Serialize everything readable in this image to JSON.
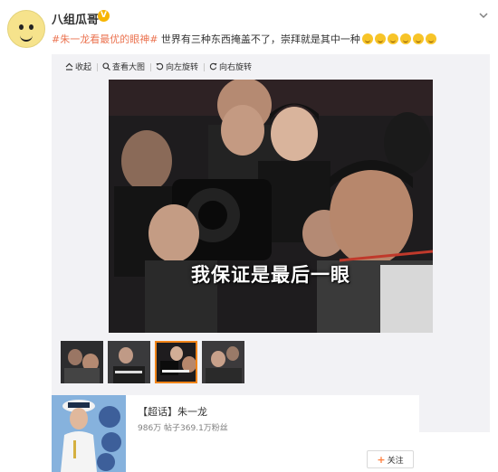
{
  "post": {
    "username": "八组瓜哥",
    "verified_badge": "V",
    "topic": "#朱一龙看最优的眼神#",
    "text": " 世界有三种东西掩盖不了，崇拜就是其中一种",
    "emoji_count": 6,
    "accent_color": "#eb7350"
  },
  "toolbar": {
    "collapse": "收起",
    "view_large": "查看大图",
    "rotate_left": "向左旋转",
    "rotate_right": "向右旋转"
  },
  "image": {
    "caption": "我保证是最后一眼"
  },
  "thumbnails": {
    "count": 4,
    "selected_index": 2
  },
  "super_topic": {
    "title": "【超话】朱一龙",
    "stats": "986万 帖子369.1万粉丝",
    "follow_label": "关注",
    "follow_plus": "+"
  }
}
